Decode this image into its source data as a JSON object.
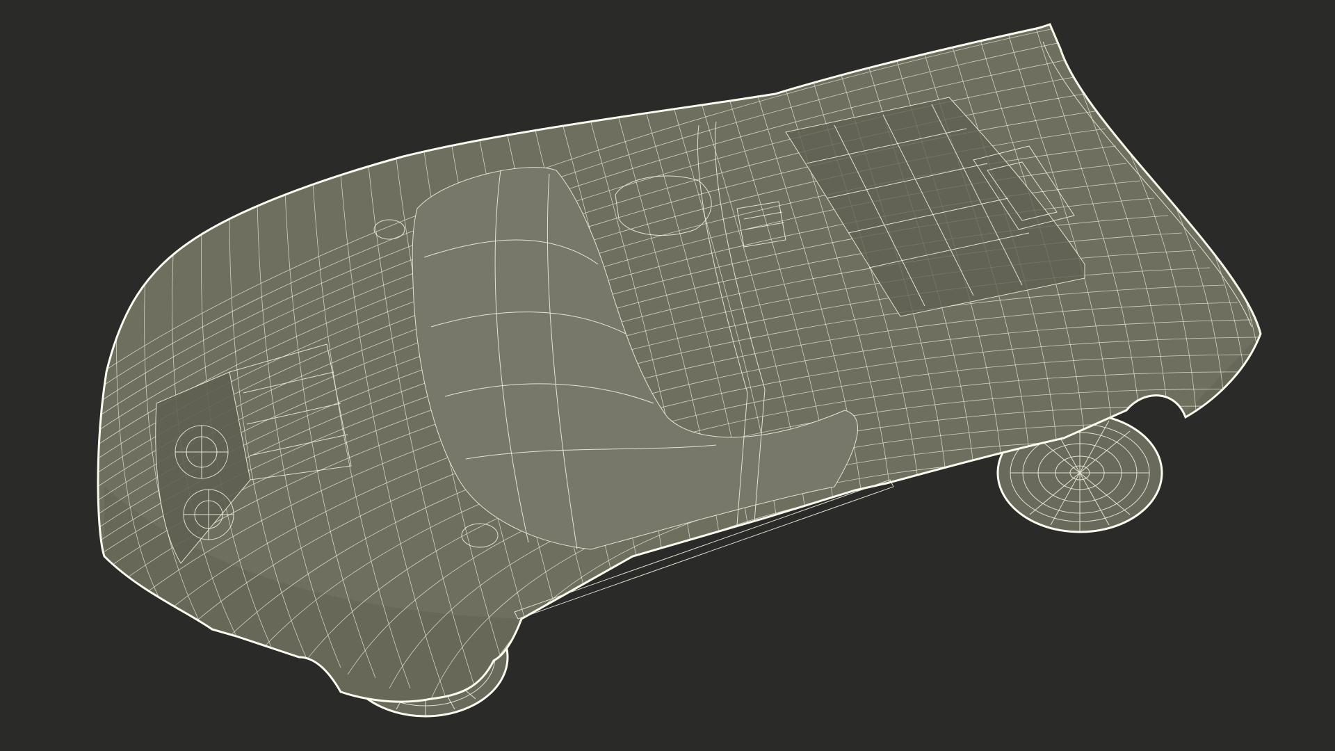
{
  "scene": {
    "subject_icon": "car-wireframe-icon",
    "background_color": "#2a2a29",
    "body_color": "#6f6f60",
    "wire_color": "#f1f0df"
  }
}
